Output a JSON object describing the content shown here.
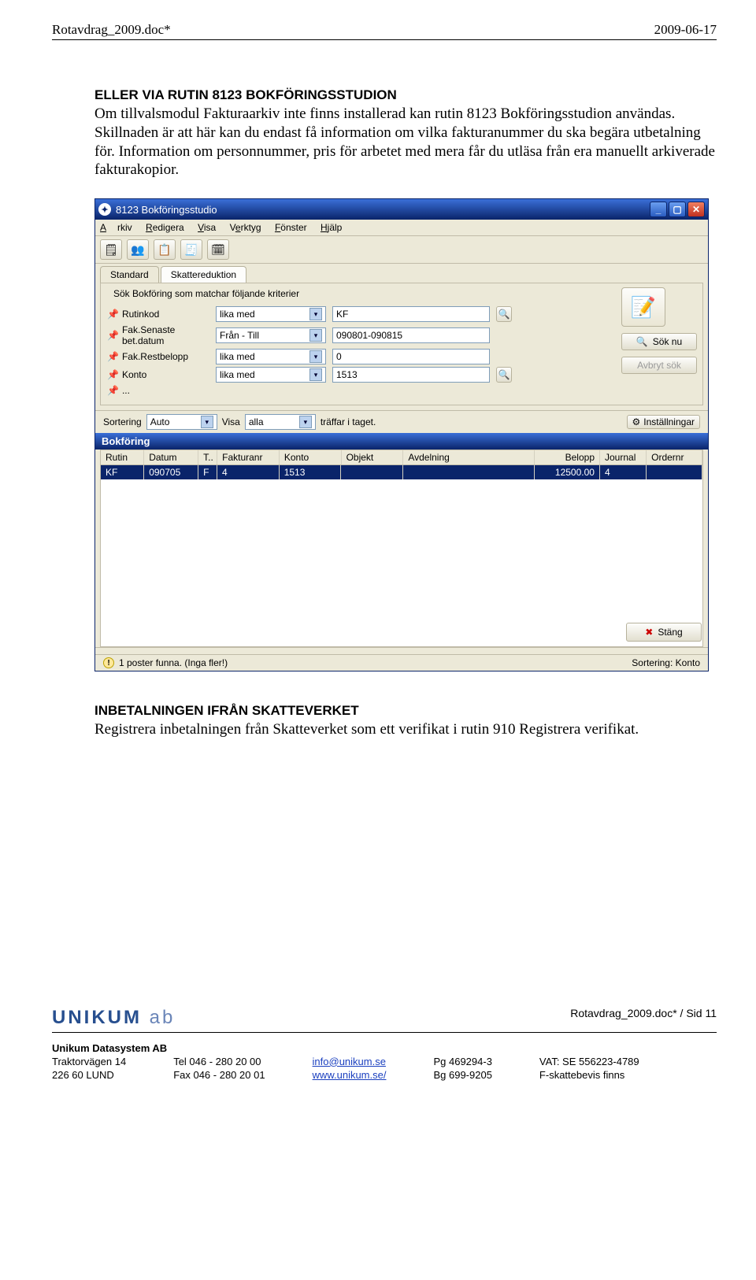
{
  "header": {
    "left": "Rotavdrag_2009.doc*",
    "right": "2009-06-17"
  },
  "sections": {
    "s1": {
      "heading": "ELLER VIA RUTIN 8123 BOKFÖRINGSSTUDION",
      "para": "Om tillvalsmodul Fakturaarkiv inte finns installerad kan rutin 8123 Bokföringsstudion användas. Skillnaden är att här kan du endast få information om vilka fakturanummer du ska begära utbetalning för. Information om personnummer, pris för arbetet med mera får du utläsa från era manuellt arkiverade fakturakopior."
    },
    "s2": {
      "heading": "INBETALNINGEN IFRÅN SKATTEVERKET",
      "para": "Registrera inbetalningen från Skatteverket som ett verifikat i rutin 910 Registrera verifikat."
    }
  },
  "window": {
    "title": "8123 Bokföringsstudio",
    "menu": {
      "arkiv": "Arkiv",
      "redigera": "Redigera",
      "visa": "Visa",
      "verktyg": "Verktyg",
      "fonster": "Fönster",
      "hjalp": "Hjälp"
    },
    "tabs": {
      "standard": "Standard",
      "skatt": "Skattereduktion"
    },
    "fieldset_title": "Sök  Bokföring som matchar följande kriterier",
    "rows": {
      "rutinkod": {
        "label": "Rutinkod",
        "op": "lika med",
        "val": "KF"
      },
      "fakdat": {
        "label": "Fak.Senaste bet.datum",
        "op": "Från - Till",
        "val": "090801-090815"
      },
      "rest": {
        "label": "Fak.Restbelopp",
        "op": "lika med",
        "val": "0"
      },
      "konto": {
        "label": "Konto",
        "op": "lika med",
        "val": "1513"
      },
      "dots": {
        "label": "..."
      }
    },
    "sok_nu": "Sök nu",
    "avbryt": "Avbryt sök",
    "sortering_label": "Sortering",
    "sort_auto": "Auto",
    "visa_label": "Visa",
    "visa_val": "alla",
    "traffar": "träffar i taget.",
    "installningar": "Inställningar",
    "band": "Bokföring",
    "cols": {
      "rutin": "Rutin",
      "datum": "Datum",
      "t": "T..",
      "fak": "Fakturanr",
      "konto": "Konto",
      "obj": "Objekt",
      "avd": "Avdelning",
      "bel": "Belopp",
      "jour": "Journal",
      "ord": "Ordernr"
    },
    "row1": {
      "rutin": "KF",
      "datum": "090705",
      "t": "F",
      "fak": "4",
      "konto": "1513",
      "obj": "",
      "avd": "",
      "bel": "12500.00",
      "jour": "4",
      "ord": ""
    },
    "stang": "Stäng",
    "status_left": "1 poster funna. (Inga fler!)",
    "status_right": "Sortering: Konto"
  },
  "footer": {
    "brand_bold": "UNIKUM",
    "brand_light": " ab",
    "page_ref": "Rotavdrag_2009.doc* / Sid 11",
    "company": "Unikum Datasystem AB",
    "cols": {
      "c1": [
        "Traktorvägen 14",
        "226 60  LUND"
      ],
      "c2": [
        "Tel  046 - 280 20 00",
        "Fax  046 - 280 20 01"
      ],
      "c3": [
        "info@unikum.se",
        "www.unikum.se/"
      ],
      "c4": [
        "Pg  469294-3",
        "Bg  699-9205"
      ],
      "c5": [
        "VAT: SE 556223-4789",
        "F-skattebevis finns"
      ]
    }
  }
}
